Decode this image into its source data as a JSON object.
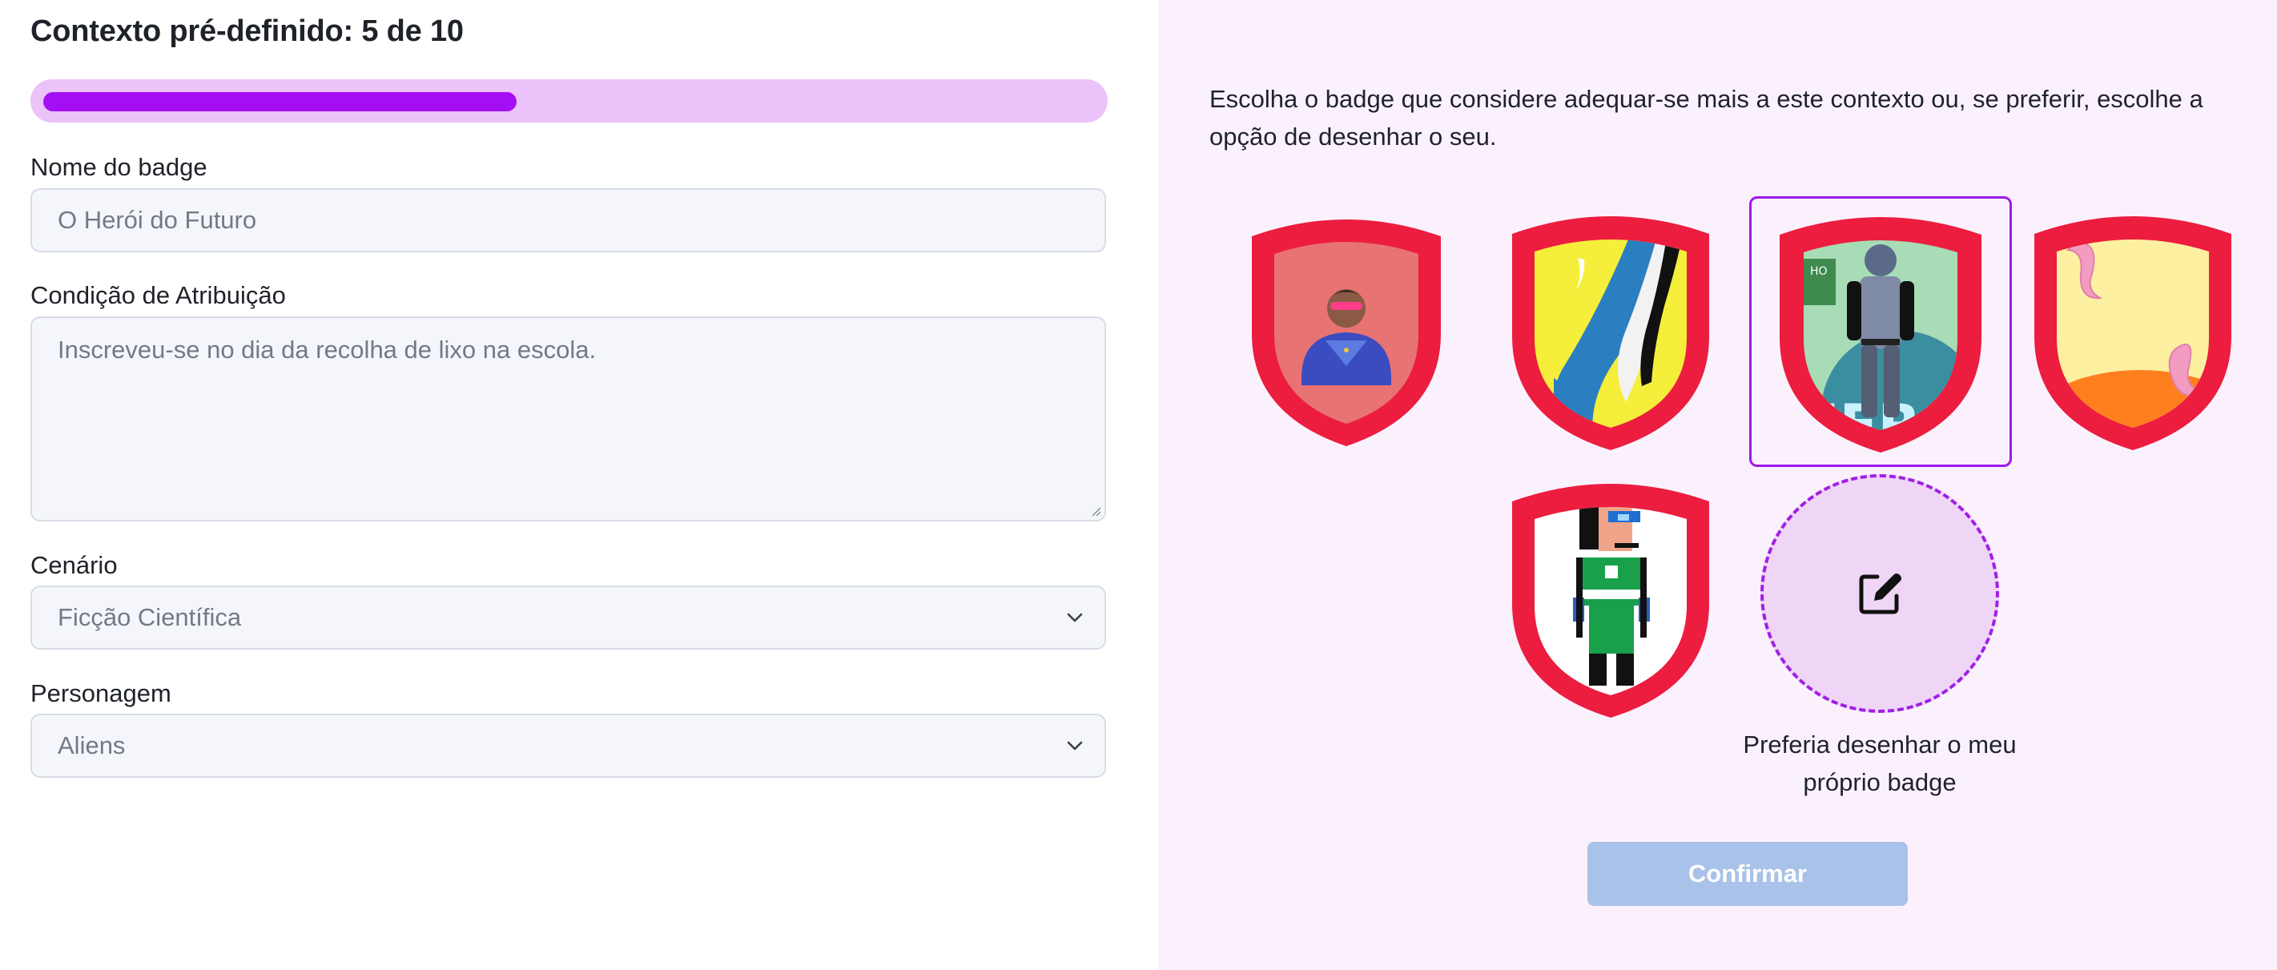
{
  "header": {
    "title": "Contexto pré-definido: 5 de 10",
    "progress": 0.45
  },
  "form": {
    "badge_name_label": "Nome do badge",
    "badge_name_value": "O Herói do Futuro",
    "condition_label": "Condição de Atribuição",
    "condition_value": "Inscreveu-se no dia da recolha de lixo na escola.",
    "scenario_label": "Cenário",
    "scenario_value": "Ficção Científica",
    "character_label": "Personagem",
    "character_value": "Aliens"
  },
  "badges": {
    "instructions": "Escolha o badge que considere adequar-se mais a este contexto ou, se preferir, escolhe a opção de desenhar o seu.",
    "options": [
      {
        "name": "superhero-avatar",
        "selected": false
      },
      {
        "name": "yellow-blue-abstract",
        "selected": false
      },
      {
        "name": "hero-silhouette",
        "selected": true,
        "text": "HERO"
      },
      {
        "name": "pink-yellow-abstract",
        "selected": false
      },
      {
        "name": "pixel-character",
        "selected": false
      }
    ],
    "draw_own_label": "Preferia desenhar o meu próprio badge",
    "confirm_label": "Confirmar"
  },
  "colors": {
    "accent": "#a30ff2",
    "progress_track": "#ebc2fa",
    "shield_red": "#ec1d3f",
    "right_panel_bg": "#fbf1fd",
    "confirm_disabled": "#a9c2e9"
  }
}
